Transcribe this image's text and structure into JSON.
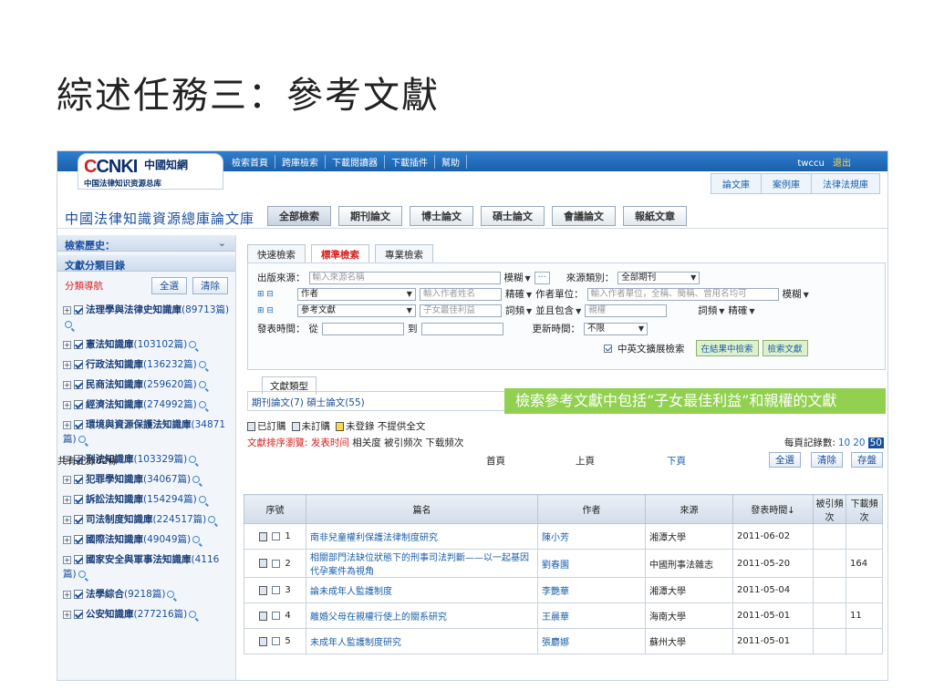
{
  "slide_title": "綜述任務三：參考文獻",
  "logo": {
    "brand_en": "CNKI",
    "url": "www.cnki.net",
    "brand_cn": "中國知網",
    "subtitle": "中国法律知识资源总库"
  },
  "top_nav": [
    "檢索首頁",
    "跨庫檢索",
    "下載閱讀器",
    "下載插件",
    "幫助"
  ],
  "user": {
    "name": "twccu",
    "logout": "退出"
  },
  "db_tabs": [
    "論文庫",
    "案例庫",
    "法律法規庫"
  ],
  "site_title": "中國法律知識資源總庫論文庫",
  "type_tabs": [
    "全部檢索",
    "期刊論文",
    "博士論文",
    "碩士論文",
    "會議論文",
    "報紙文章"
  ],
  "sidebar": {
    "history_label": "檢索歷史：",
    "catalog_label": "文獻分類目錄",
    "nav_label": "分類導航",
    "select_all": "全選",
    "clear": "清除",
    "categories": [
      {
        "name": "法理學與法律史知識庫",
        "count": "(89713篇)"
      },
      {
        "name": "憲法知識庫",
        "count": "(103102篇)"
      },
      {
        "name": "行政法知識庫",
        "count": "(136232篇)"
      },
      {
        "name": "民商法知識庫",
        "count": "(259620篇)"
      },
      {
        "name": "經濟法知識庫",
        "count": "(274992篇)"
      },
      {
        "name": "環境與資源保護法知識庫",
        "count": "(34871篇)"
      },
      {
        "name": "刑法知識庫",
        "count": "(103329篇)"
      },
      {
        "name": "犯罪學知識庫",
        "count": "(34067篇)"
      },
      {
        "name": "訴訟法知識庫",
        "count": "(154294篇)"
      },
      {
        "name": "司法制度知識庫",
        "count": "(224517篇)"
      },
      {
        "name": "國際法知識庫",
        "count": "(49049篇)"
      },
      {
        "name": "國家安全與軍事法知識庫",
        "count": "(4116篇)"
      },
      {
        "name": "法學綜合",
        "count": "(9218篇)"
      },
      {
        "name": "公安知識庫",
        "count": "(277216篇)"
      }
    ]
  },
  "search_tabs": [
    "快速檢索",
    "標準檢索",
    "專業檢索"
  ],
  "form": {
    "source_label": "出版來源：",
    "source_placeholder": "輸入來源名稱",
    "fuzzy": "模糊",
    "ellipsis": "···",
    "source_type_label": "來源類別：",
    "source_type_value": "全部期刊",
    "plusminus": "⊞ ⊟",
    "author_sel": "作者",
    "author_placeholder": "輸入作者姓名",
    "exact": "精確",
    "org_label": "作者單位：",
    "org_placeholder": "輸入作者單位，全稱、簡稱、曾用名均可",
    "ref_sel": "參考文獻",
    "ref_value": "子女最佳利益",
    "freq": "詞頻",
    "and_include": "並且包含",
    "ref_value2": "親權",
    "date_label": "發表時間：",
    "from": "從",
    "to": "到",
    "update_label": "更新時間：",
    "update_value": "不限",
    "cn_en": "中英文擴展檢索",
    "in_results": "在結果中檢索",
    "search_btn": "檢索文獻"
  },
  "doctype_label": "文獻類型",
  "doctype_counts": "期刊論文(7)  碩士論文(55)",
  "callout": "檢索參考文獻中包括“子女最佳利益”和親權的文獻",
  "legend": [
    "已訂購",
    "未訂購",
    "未登錄 不提供全文"
  ],
  "sort": {
    "label": "文獻排序瀏覽:",
    "options": [
      "发表时间",
      "相关度",
      "被引频次",
      "下载频次"
    ],
    "per_page_label": "每頁記錄數:",
    "per_page": [
      "10",
      "20",
      "50"
    ]
  },
  "pager": {
    "total": "共有記錄62條",
    "first": "首頁",
    "prev": "上頁",
    "next": "下頁",
    "select_all": "全選",
    "clear": "清除",
    "save": "存盤"
  },
  "table": {
    "headers": [
      "序號",
      "篇名",
      "作者",
      "來源",
      "發表時間↓",
      "被引頻次",
      "下載頻次"
    ],
    "rows": [
      {
        "no": "1",
        "title": "南非兒童權利保護法律制度研究",
        "author": "陳小芳",
        "source": "湘潭大學",
        "date": "2011-06-02",
        "cited": "",
        "downloads": ""
      },
      {
        "no": "2",
        "title": "相關部門法缺位狀態下的刑事司法判斷——以一起基因代孕案件為視角",
        "author": "劉春園",
        "source": "中國刑事法雜志",
        "date": "2011-05-20",
        "cited": "",
        "downloads": "164"
      },
      {
        "no": "3",
        "title": "論未成年人監護制度",
        "author": "李艷華",
        "source": "湘潭大學",
        "date": "2011-05-04",
        "cited": "",
        "downloads": ""
      },
      {
        "no": "4",
        "title": "離婚父母在親權行使上的關系研究",
        "author": "王晨華",
        "source": "海南大學",
        "date": "2011-05-01",
        "cited": "",
        "downloads": "11"
      },
      {
        "no": "5",
        "title": "未成年人監護制度研究",
        "author": "張麝娜",
        "source": "蘇州大學",
        "date": "2011-05-01",
        "cited": "",
        "downloads": ""
      }
    ]
  }
}
